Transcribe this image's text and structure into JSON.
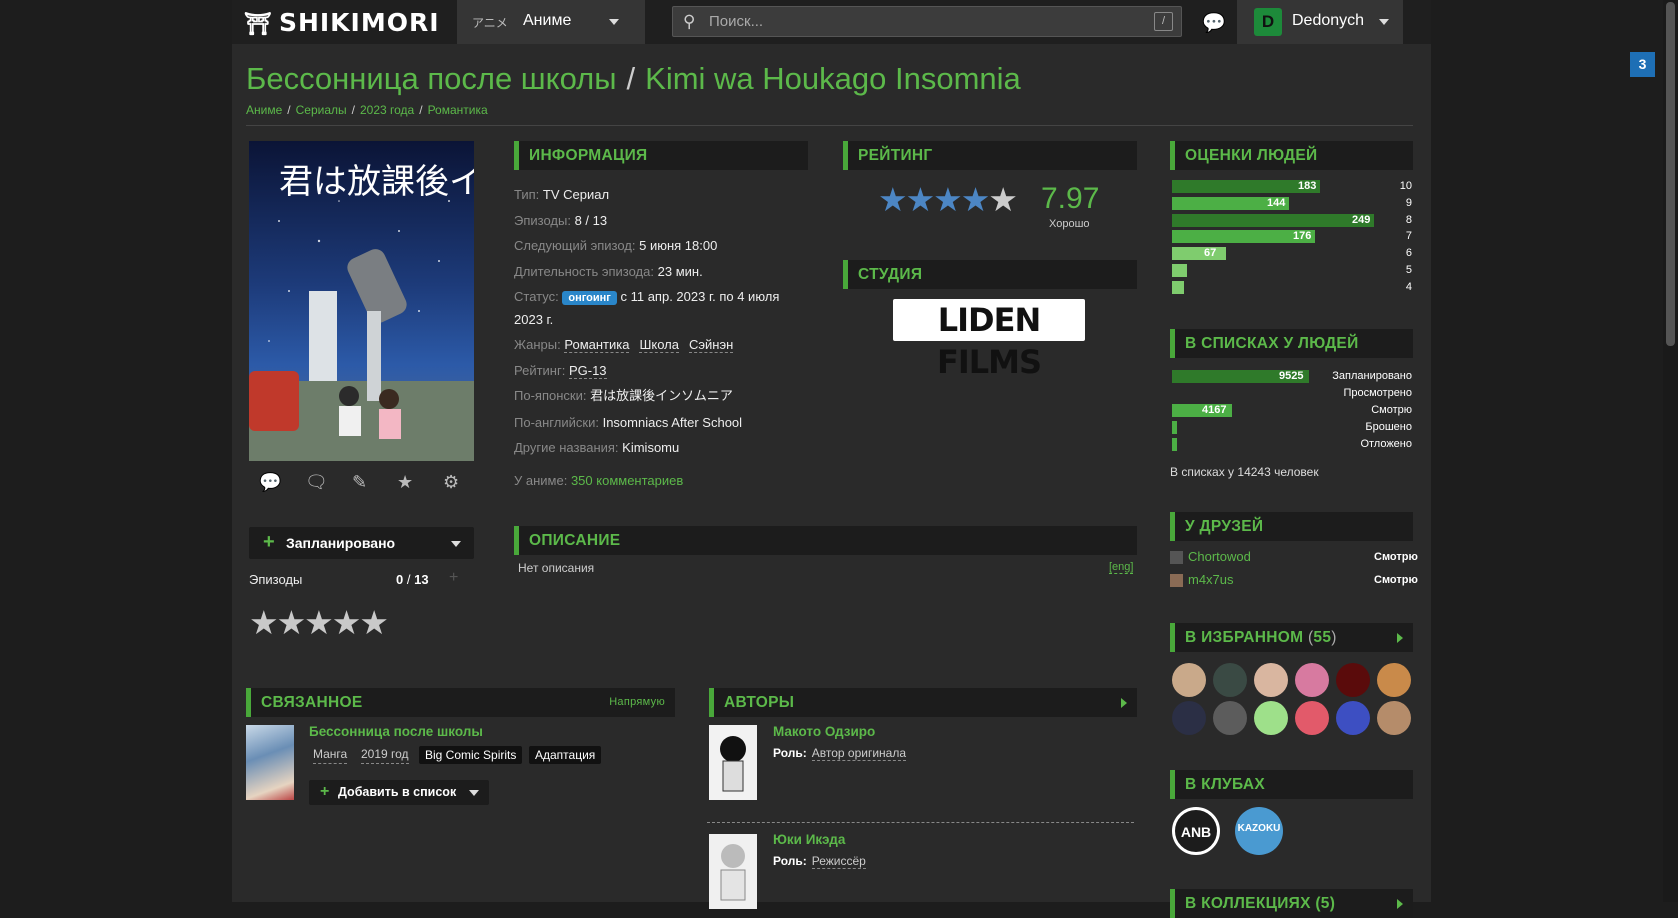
{
  "header": {
    "logo": "SHIKIMORI",
    "section_jp": "アニメ",
    "section": "Аниме",
    "search_placeholder": "Поиск...",
    "search_hotkey": "/",
    "username": "Dedonych",
    "notifications": "3"
  },
  "title": {
    "ru": "Бессонница после школы",
    "sep": "/",
    "jp": "Kimi wa Houkago Insomnia"
  },
  "breadcrumbs": [
    {
      "label": "Аниме"
    },
    {
      "label": "Сериалы"
    },
    {
      "label": "2023 года"
    },
    {
      "label": "Романтика"
    }
  ],
  "breadcrumb_sep": "/",
  "poster": {
    "caption_jp": "君は放課後インソムニア"
  },
  "user_rate": {
    "status": "Запланировано",
    "episodes_label": "Эпизоды",
    "episodes_value": "0",
    "episodes_sep": "/",
    "episodes_total": "13",
    "plus": "+",
    "stars": "★★★★★"
  },
  "info": {
    "header": "ИНФОРМАЦИЯ",
    "type_k": "Тип:",
    "type_v": "TV Сериал",
    "episodes_k": "Эпизоды:",
    "episodes_v": "8 / 13",
    "next_k": "Следующий эпизод:",
    "next_v": "5 июня 18:00",
    "duration_k": "Длительность эпизода:",
    "duration_v": "23 мин.",
    "status_k": "Статус:",
    "status_badge": "онгоинг",
    "status_v": "с 11 апр. 2023 г. по 4 июля 2023 г.",
    "genres_k": "Жанры:",
    "genres": [
      "Романтика",
      "Школа",
      "Сэйнэн"
    ],
    "rating_k": "Рейтинг:",
    "rating_v": "PG-13",
    "jp_k": "По-японски:",
    "jp_v": "君は放課後インソムニア",
    "en_k": "По-английски:",
    "en_v": "Insomniacs After School",
    "other_k": "Другие названия:",
    "other_v": "Kimisomu",
    "comments_k": "У аниме:",
    "comments_v": "350 комментариев"
  },
  "rating": {
    "header": "РЕЙТИНГ",
    "score": "7.97",
    "word": "Хорошо",
    "stars_filled": 4,
    "stars_total": 5
  },
  "studio": {
    "header": "СТУДИЯ",
    "name": "LIDEN FILMS"
  },
  "description": {
    "header": "ОПИСАНИЕ",
    "text": "Нет описания",
    "lang": "[eng]"
  },
  "scores": {
    "header": "ОЦЕНКИ ЛЮДЕЙ",
    "rows": [
      {
        "score": "10",
        "count": 183
      },
      {
        "score": "9",
        "count": 144
      },
      {
        "score": "8",
        "count": 249
      },
      {
        "score": "7",
        "count": 176
      },
      {
        "score": "6",
        "count": 67
      },
      {
        "score": "5",
        "count": 19
      },
      {
        "score": "4",
        "count": 12
      }
    ]
  },
  "lists": {
    "header": "В СПИСКАХ У ЛЮДЕЙ",
    "rows": [
      {
        "label": "Запланировано",
        "count": 9525
      },
      {
        "label": "Просмотрено",
        "count": 0
      },
      {
        "label": "Смотрю",
        "count": 4167
      },
      {
        "label": "Брошено",
        "count": 300
      },
      {
        "label": "Отложено",
        "count": 250
      }
    ],
    "total": "В списках у 14243 человек"
  },
  "friends": {
    "header": "У ДРУЗЕЙ",
    "items": [
      {
        "name": "Chortowod",
        "status": "Смотрю"
      },
      {
        "name": "m4x7us",
        "status": "Смотрю"
      }
    ]
  },
  "favourites": {
    "header": "В ИЗБРАННОМ",
    "count": "55"
  },
  "clubs": {
    "header": "В КЛУБАХ",
    "items": [
      "ANB",
      "KAZOKU"
    ]
  },
  "collections": {
    "header": "В КОЛЛЕКЦИЯХ (5)"
  },
  "related": {
    "header": "СВЯЗАННОЕ",
    "mode": "Напрямую",
    "title": "Бессонница после школы",
    "kind": "Манга",
    "year": "2019 год",
    "magazine": "Big Comic Spirits",
    "relation": "Адаптация",
    "add": "Добавить в список"
  },
  "authors": {
    "header": "АВТОРЫ",
    "role_k": "Роль:",
    "items": [
      {
        "name": "Макото Одзиро",
        "role": "Автор оригинала"
      },
      {
        "name": "Юки Икэда",
        "role": "Режиссёр"
      }
    ]
  }
}
